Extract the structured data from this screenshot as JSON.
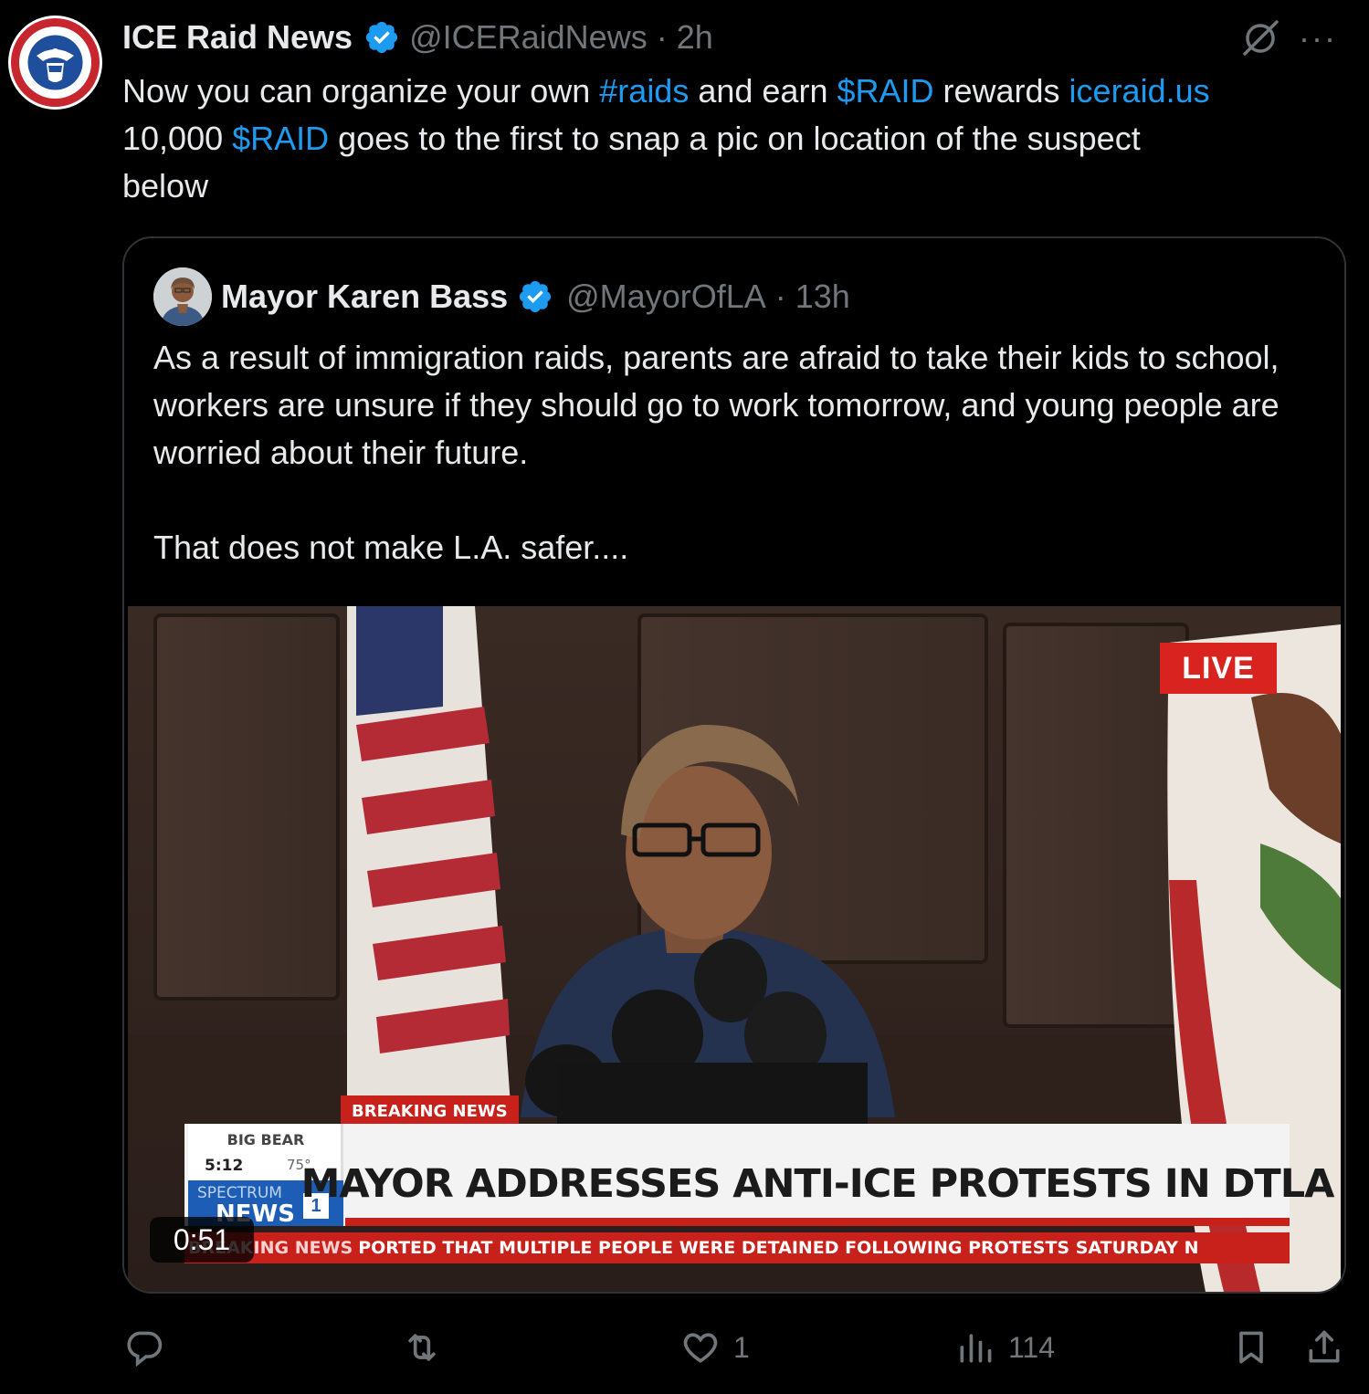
{
  "tweet": {
    "author_name": "ICE Raid News",
    "handle": "@ICERaidNews",
    "separator": "·",
    "time": "2h",
    "line1": {
      "p1": "Now you can organize your own ",
      "hashtag": "#raids",
      "p2": " and earn ",
      "cashtag": "$RAID",
      "p3": " rewards ",
      "link": "iceraid.us"
    },
    "line2": {
      "p1": "10,000 ",
      "cashtag": "$RAID",
      "p2": " goes to the first to snap a pic on location of the suspect"
    },
    "line3": "below",
    "more": "···"
  },
  "quote": {
    "author_name": "Mayor Karen Bass",
    "handle": "@MayorOfLA",
    "separator": "·",
    "time": "13h",
    "paragraph1": "As a result of immigration raids, parents are afraid to take their kids to school, workers are unsure if they should go to work tomorrow, and young people are worried about their future.",
    "paragraph2": "That does not make L.A. safer....",
    "video": {
      "live_badge": "LIVE",
      "breaking_label": "BREAKING NEWS",
      "headline": "MAYOR ADDRESSES ANTI-ICE PROTESTS IN DTLA",
      "weather_location": "BIG BEAR",
      "weather_time": "5:12",
      "weather_temp": "75°",
      "network_word": "SPECTRUM",
      "network_news": "NEWS",
      "network_num": "1",
      "crawl_label": "BREAKING NEWS",
      "crawl_text": "PORTED THAT MULTIPLE PEOPLE WERE DETAINED FOLLOWING PROTESTS SATURDAY N",
      "duration": "0:51"
    }
  },
  "actions": {
    "reply_count": "",
    "retweet_count": "",
    "like_count": "1",
    "views_count": "114"
  },
  "colors": {
    "background": "#000000",
    "text": "#e7e9ea",
    "muted": "#71767b",
    "accent": "#1d9bf0",
    "border": "#2f3336"
  },
  "icons": [
    "reply-icon",
    "retweet-icon",
    "like-icon",
    "views-icon",
    "bookmark-icon",
    "share-icon",
    "grok-icon",
    "more-icon",
    "verified-icon"
  ]
}
